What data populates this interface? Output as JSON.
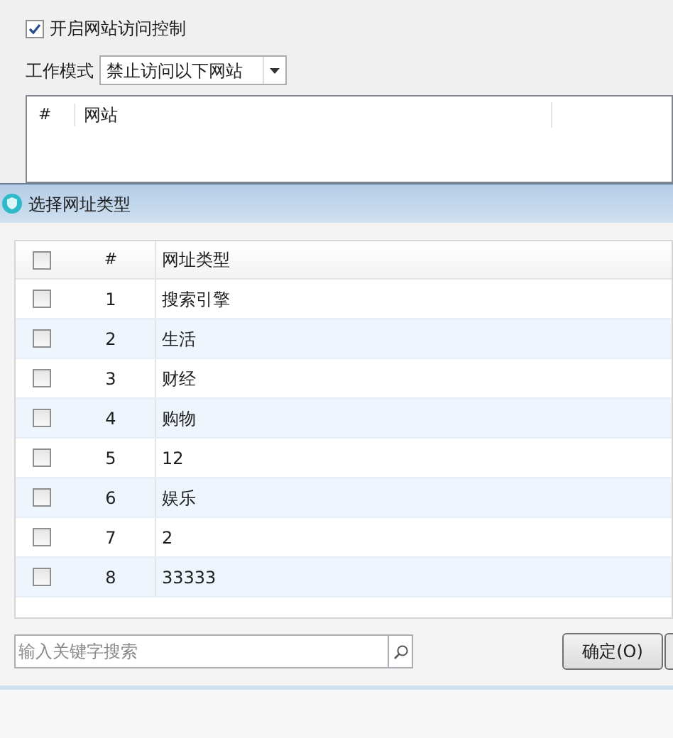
{
  "enable_control": {
    "label": "开启网站访问控制",
    "checked": true
  },
  "work_mode": {
    "label": "工作模式",
    "value": "禁止访问以下网站"
  },
  "site_list": {
    "columns": [
      "#",
      "网站"
    ]
  },
  "dialog": {
    "title": "选择网址类型",
    "table": {
      "select_all_checked": false,
      "columns": [
        "#",
        "网址类型"
      ],
      "rows": [
        {
          "index": "1",
          "type": "搜索引擎",
          "checked": false
        },
        {
          "index": "2",
          "type": "生活",
          "checked": false
        },
        {
          "index": "3",
          "type": "财经",
          "checked": false
        },
        {
          "index": "4",
          "type": "购物",
          "checked": false
        },
        {
          "index": "5",
          "type": "12",
          "checked": false
        },
        {
          "index": "6",
          "type": "娱乐",
          "checked": false
        },
        {
          "index": "7",
          "type": "2",
          "checked": false
        },
        {
          "index": "8",
          "type": "33333",
          "checked": false
        }
      ]
    },
    "search": {
      "placeholder": "输入关键字搜索"
    },
    "ok_button": "确定(O)"
  }
}
